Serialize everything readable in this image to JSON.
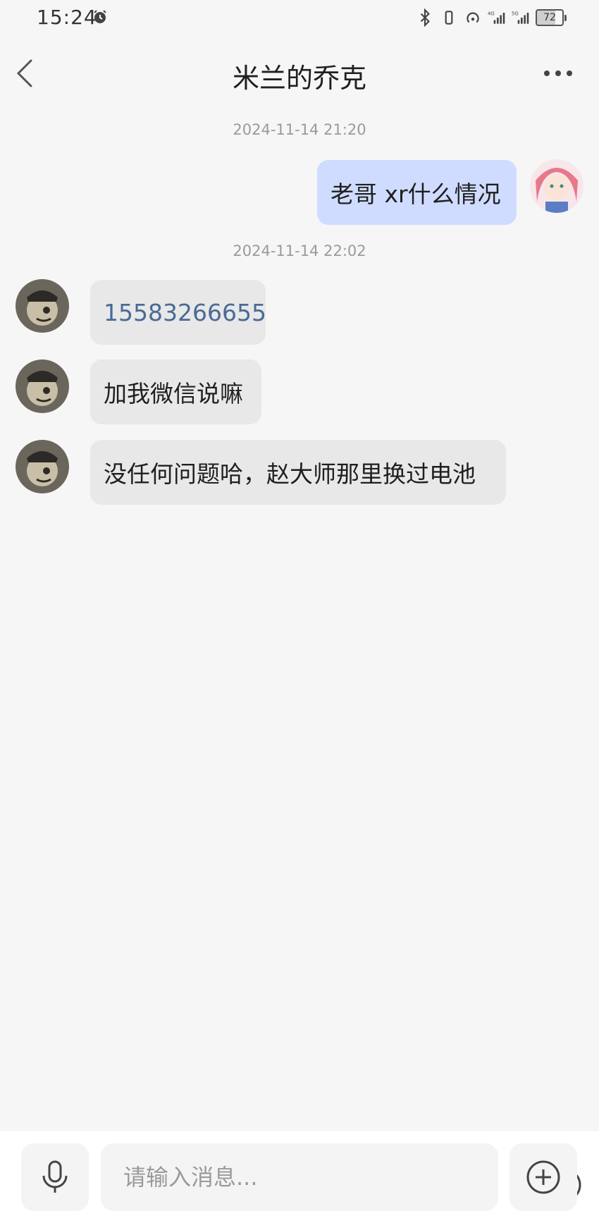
{
  "status_bar": {
    "time": "15:24",
    "network_1": "4G",
    "network_2": "5G",
    "battery": "72"
  },
  "header": {
    "title": "米兰的乔克"
  },
  "messages": [
    {
      "type": "timestamp",
      "text": "2024-11-14 21:20"
    },
    {
      "type": "outgoing",
      "text": "老哥  xr什么情况"
    },
    {
      "type": "timestamp",
      "text": "2024-11-14 22:02"
    },
    {
      "type": "incoming",
      "text": "15583266655",
      "is_link": true
    },
    {
      "type": "incoming",
      "text": "加我微信说嘛"
    },
    {
      "type": "incoming",
      "text": "没任何问题哈，赵大师那里换过电池"
    }
  ],
  "input": {
    "placeholder": "请输入消息..."
  },
  "icons": {
    "voice": "microphone-icon",
    "emoji": "emoji-icon",
    "plus": "plus-icon",
    "back": "chevron-left-icon",
    "more": "more-icon"
  },
  "colors": {
    "background": "#f6f6f6",
    "incoming_bubble": "#e8e8e8",
    "outgoing_bubble": "#cfdcff",
    "link": "#4a6a96"
  }
}
